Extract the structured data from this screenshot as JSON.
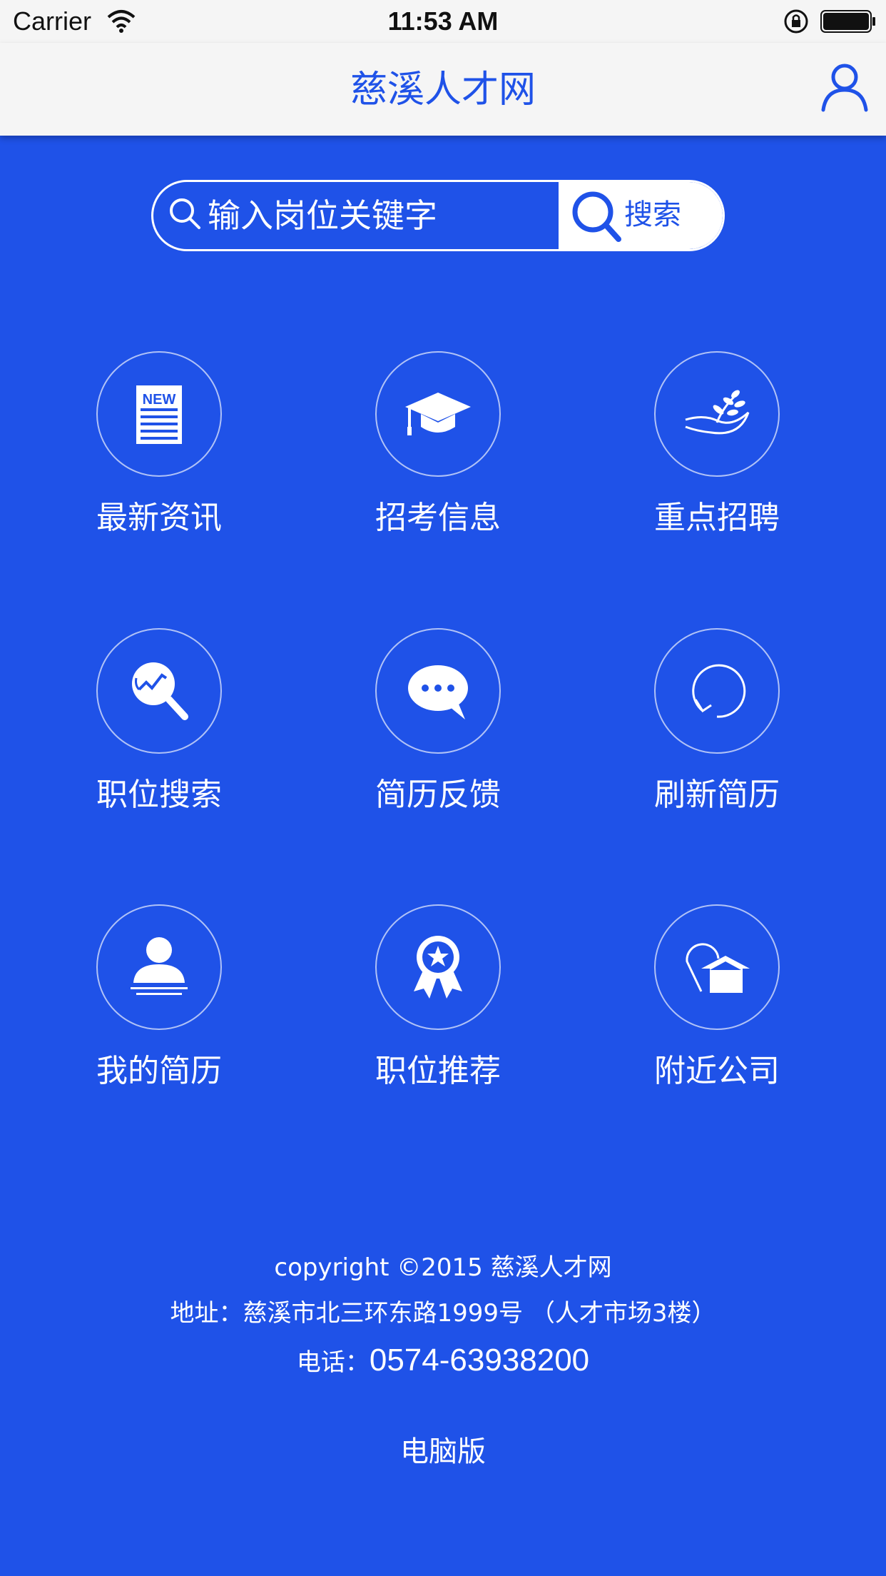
{
  "status_bar": {
    "carrier": "Carrier",
    "time": "11:53 AM"
  },
  "nav": {
    "title": "慈溪人才网",
    "user_icon": "user-icon"
  },
  "search": {
    "placeholder": "输入岗位关键字",
    "button_label": "搜索"
  },
  "grid": {
    "items": [
      {
        "label": "最新资讯",
        "icon": "news-icon"
      },
      {
        "label": "招考信息",
        "icon": "graduation-cap-icon"
      },
      {
        "label": "重点招聘",
        "icon": "hand-plant-icon"
      },
      {
        "label": "职位搜索",
        "icon": "search-trend-icon"
      },
      {
        "label": "简历反馈",
        "icon": "chat-bubble-icon"
      },
      {
        "label": "刷新简历",
        "icon": "refresh-icon"
      },
      {
        "label": "我的简历",
        "icon": "person-icon"
      },
      {
        "label": "职位推荐",
        "icon": "award-ribbon-icon"
      },
      {
        "label": "附近公司",
        "icon": "location-house-icon"
      }
    ]
  },
  "footer": {
    "copyright": "copyright ©2015 慈溪人才网",
    "address": "地址：慈溪市北三环东路1999号 （人才市场3楼）",
    "phone_label": "电话：",
    "phone_number": "0574-63938200",
    "pc_version": "电脑版"
  },
  "colors": {
    "background": "#1f52e8",
    "nav_background": "#f5f5f5",
    "accent": "#1f52e8",
    "text_light": "#ffffff"
  }
}
